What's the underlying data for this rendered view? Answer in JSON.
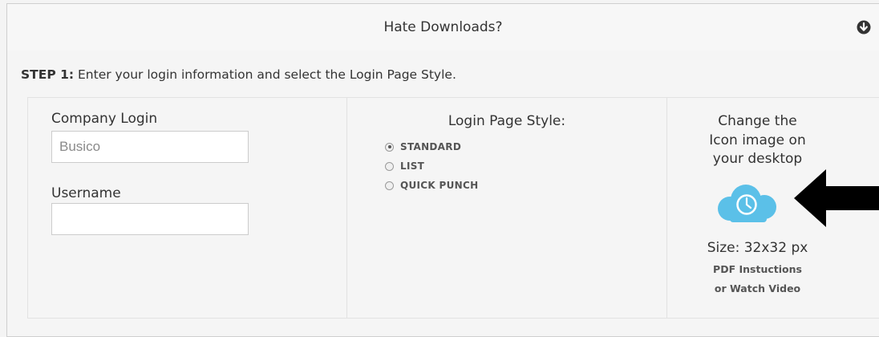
{
  "header": {
    "title": "Hate Downloads?",
    "toggle_icon": "chevron-down-circle-icon"
  },
  "step": {
    "label": "STEP 1:",
    "text": " Enter your login information and select the Login Page Style."
  },
  "login": {
    "company_label": "Company Login",
    "company_value": "Busico",
    "username_label": "Username",
    "username_value": ""
  },
  "style": {
    "title": "Login Page Style:",
    "options": [
      {
        "label": "STANDARD",
        "checked": true
      },
      {
        "label": "LIST",
        "checked": false
      },
      {
        "label": "QUICK PUNCH",
        "checked": false
      }
    ]
  },
  "icon_panel": {
    "change_line1": "Change the",
    "change_line2": "Icon image on",
    "change_line3": "your desktop",
    "cloud_icon": "cloud-clock-icon",
    "arrow_icon": "arrow-left-icon",
    "size_text": "Size: 32x32 px",
    "pdf_link": "PDF Instuctions",
    "video_link": "or Watch Video"
  },
  "colors": {
    "cloud": "#5bc0e8",
    "arrow": "#000000"
  }
}
